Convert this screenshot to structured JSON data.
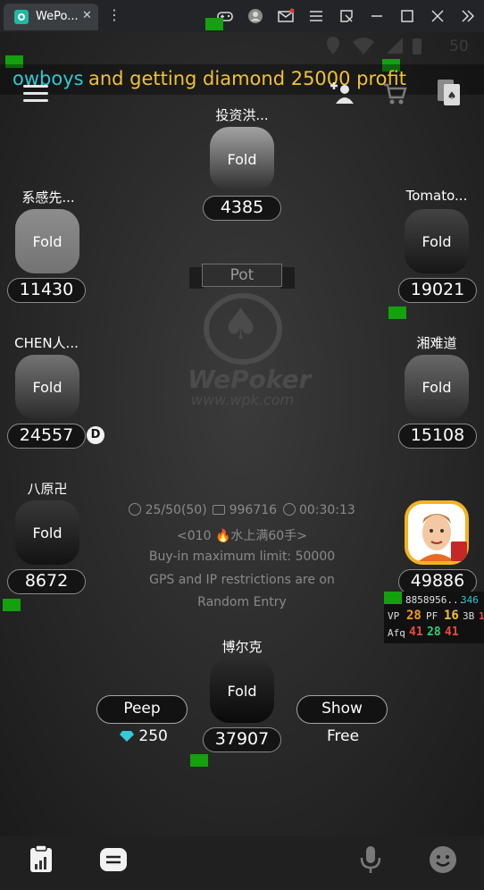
{
  "window": {
    "tab_title": "WePo...",
    "tab_close": "✕",
    "more": "⋮",
    "toolbar_icons": [
      "gamepad-icon",
      "user-icon",
      "mail-icon",
      "menu-icon",
      "resize-icon",
      "minimize-icon",
      "maximize-icon",
      "close-icon",
      "chevrons-right-icon"
    ],
    "status_right": "50"
  },
  "ticker": {
    "part_cyan": "owboys",
    "part_yellow": "and getting diamond 25000 profit"
  },
  "pot": {
    "label": "Pot"
  },
  "logo": {
    "brand": "WePoker",
    "url": "www.wpk.com"
  },
  "players": [
    {
      "id": "top",
      "name": "投资洪...",
      "status": "Fold",
      "stack": "4385"
    },
    {
      "id": "left1",
      "name": "系感先...",
      "status": "Fold",
      "stack": "11430"
    },
    {
      "id": "right1",
      "name": "Tomato...",
      "status": "Fold",
      "stack": "19021"
    },
    {
      "id": "left2",
      "name": "CHEN人...",
      "status": "Fold",
      "stack": "24557"
    },
    {
      "id": "right2",
      "name": "湘难道",
      "status": "Fold",
      "stack": "15108"
    },
    {
      "id": "left3",
      "name": "八原卍",
      "status": "Fold",
      "stack": "8672"
    },
    {
      "id": "right3",
      "name": "",
      "status": "",
      "stack": "49886"
    },
    {
      "id": "hero",
      "name": "博尔克",
      "status": "Fold",
      "stack": "37907"
    }
  ],
  "dealer": "D",
  "game_info": {
    "blinds": "25/50(50)",
    "table_id": "996716",
    "timer": "00:30:13",
    "rule_line": "<010 🔥水上满60手>",
    "line3": "Buy-in maximum limit: 50000",
    "line4": "GPS and IP restrictions are on",
    "line5": "Random Entry"
  },
  "actions": {
    "peep_label": "Peep",
    "peep_cost": "250",
    "show_label": "Show",
    "show_cost": "Free"
  },
  "stats": {
    "id": "8858956...",
    "count": "346",
    "vp_label": "VP",
    "vp": "28",
    "pf_label": "PF",
    "pf": "16",
    "b3_label": "3B",
    "b3": "1",
    "afq_label": "Afq",
    "afq1": "41",
    "afq2": "28",
    "afq3": "41"
  },
  "colors": {
    "ticker_cyan": "#2ec8d4",
    "ticker_yellow": "#f1c232",
    "marker_green": "#13a10e",
    "diamond": "#36c9d8"
  }
}
